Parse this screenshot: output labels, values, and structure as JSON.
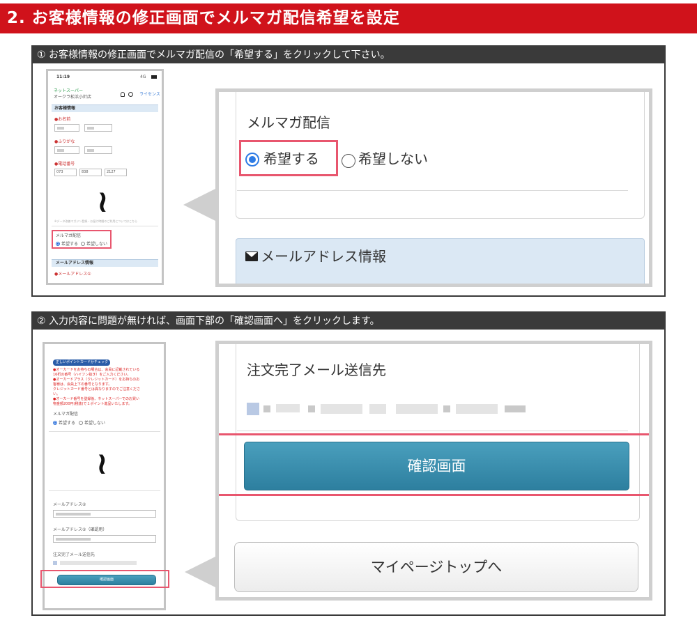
{
  "header": {
    "title": "2. お客様情報の修正画面でメルマガ配信希望を設定"
  },
  "step1": {
    "instruction": "① お客様情報の修正画面でメルマガ配信の「希望する」をクリックして下さい。",
    "phone": {
      "time": "11:19",
      "signal": "4G",
      "brand": "ネットスーパー",
      "store": "オークラ松浜小針店",
      "nav_right": "ライセンス",
      "section_title": "お客様情報",
      "name_label": "●お名前",
      "kana_label": "●ふりがな",
      "phone_label": "●電話番号",
      "phone_values": [
        "073",
        "838",
        "2127"
      ],
      "note": "※データ改善マガジン登録・お届け時間のご利用についてはこちら",
      "mailmag_label": "メルマガ配信",
      "opt_yes": "希望する",
      "opt_no": "希望しない",
      "mail_section": "メールアドレス情報",
      "mail_label": "●メールアドレス①"
    },
    "zoom": {
      "mailmag_label": "メルマガ配信",
      "opt_yes": "希望する",
      "opt_no": "希望しない",
      "mail_section": "メールアドレス情報"
    }
  },
  "step2": {
    "instruction": "② 入力内容に問題が無ければ、画面下部の「確認画面へ」をクリックします。",
    "phone": {
      "badge": "正しいポイントカードかチェック",
      "warning_lines": [
        "●オーカードをお持ちの場合は、会員に記載されている",
        "16桁の番号（ハイフン抜き）をご入力ください。",
        "●オーカードプラス（クレジットカード）をお持ちのお",
        "客様は、会員上下の番号となります。",
        "クレジットカード番号とは異なりますのでご注意くださ",
        "い。",
        "●オーカード番号を登録後、ネットスーパーでのお買い",
        "物金額200円(税抜)で１ポイント進呈いたします。"
      ],
      "mailmag_label": "メルマガ配信",
      "opt_yes": "希望する",
      "opt_no": "希望しない",
      "mail2_label": "メールアドレス②",
      "mail2_confirm_label": "メールアドレス②（確認用）",
      "order_mail_label": "注文完了メール送信先",
      "confirm_button": "確認画面"
    },
    "zoom": {
      "order_mail_label": "注文完了メール送信先",
      "confirm_button": "確認画面",
      "mypage_button": "マイページトップへ"
    }
  },
  "colors": {
    "header_bg": "#d0121b",
    "step_bar_bg": "#3a3a3a",
    "highlight": "#e8566e",
    "confirm_button": "#2d7f9f",
    "radio_selected": "#2d7be5",
    "section_bg": "#dbe8f4"
  }
}
